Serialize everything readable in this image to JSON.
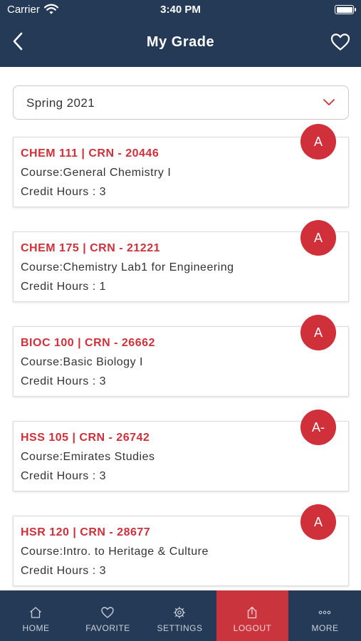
{
  "status_bar": {
    "carrier": "Carrier",
    "time": "3:40 PM"
  },
  "header": {
    "title": "My Grade"
  },
  "term_select": {
    "value": "Spring 2021"
  },
  "courses": [
    {
      "code": "CHEM 111 | CRN - 20446",
      "course": "Course:General Chemistry I",
      "credit": "Credit Hours : 3",
      "grade": "A"
    },
    {
      "code": "CHEM 175 | CRN - 21221",
      "course": "Course:Chemistry Lab1 for Engineering",
      "credit": "Credit Hours : 1",
      "grade": "A"
    },
    {
      "code": "BIOC 100 | CRN - 26662",
      "course": "Course:Basic Biology I",
      "credit": "Credit Hours : 3",
      "grade": "A"
    },
    {
      "code": "HSS 105 | CRN - 26742",
      "course": "Course:Emirates Studies",
      "credit": "Credit Hours : 3",
      "grade": "A-"
    },
    {
      "code": "HSR 120 | CRN - 28677",
      "course": "Course:Intro. to Heritage & Culture",
      "credit": "Credit Hours : 3",
      "grade": "A"
    }
  ],
  "tabbar": {
    "home": "HOME",
    "favorite": "FAVORITE",
    "settings": "SETTINGS",
    "logout": "LOGOUT",
    "more": "MORE"
  },
  "colors": {
    "navy": "#253a56",
    "accent_red": "#d0303a"
  },
  "icons": [
    "wifi-icon",
    "battery-icon",
    "back-chevron-icon",
    "heart-icon",
    "chevron-down-icon",
    "home-icon",
    "heart-icon",
    "gear-icon",
    "share-icon",
    "more-dots-icon"
  ]
}
